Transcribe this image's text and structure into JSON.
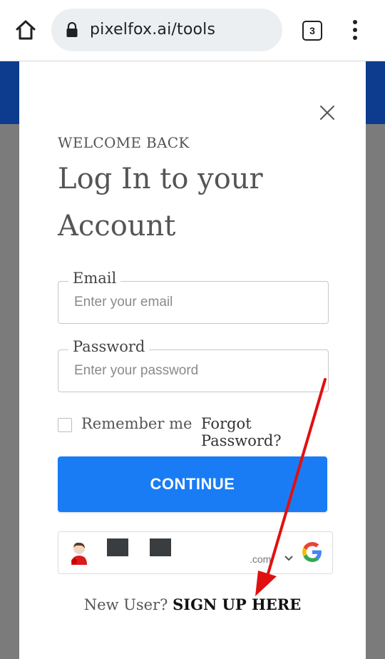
{
  "browser": {
    "url": "pixelfox.ai/tools",
    "tab_count": "3",
    "icons": [
      "home-icon",
      "lock-icon",
      "tabs-icon",
      "more-icon"
    ]
  },
  "modal": {
    "eyebrow": "WELCOME BACK",
    "title": "Log In to your Account",
    "email": {
      "label": "Email",
      "placeholder": "Enter your email",
      "value": ""
    },
    "password": {
      "label": "Password",
      "placeholder": "Enter your password",
      "value": ""
    },
    "remember_label": "Remember me",
    "remember_checked": false,
    "forgot_label": "Forgot Password?",
    "continue_label": "CONTINUE",
    "google": {
      "domain": ".com"
    },
    "signup_question": "New User?",
    "signup_link": "SIGN UP HERE"
  },
  "colors": {
    "primary": "#1a7cf5",
    "header_blue": "#0d3c8e",
    "overlay_gray": "#7b7b7b",
    "annotation_red": "#e01010"
  }
}
